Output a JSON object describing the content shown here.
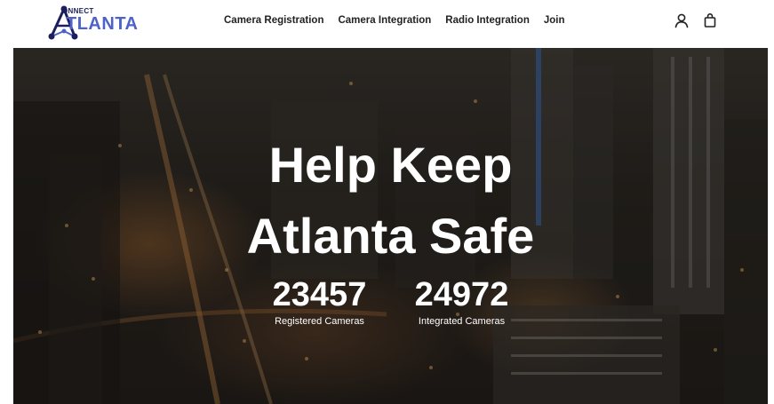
{
  "header": {
    "logo": {
      "connect_text": "ONNECT",
      "atlanta_text": "TLANTA",
      "icon": "connect-atlanta-logo-icon",
      "color_primary": "#4e62c8",
      "color_dark": "#1b1f5e"
    },
    "nav": [
      {
        "label": "Camera Registration"
      },
      {
        "label": "Camera Integration"
      },
      {
        "label": "Radio Integration"
      },
      {
        "label": "Join"
      }
    ],
    "icons": {
      "account": "user-icon",
      "cart": "shopping-bag-icon"
    }
  },
  "hero": {
    "title_line1": "Help Keep",
    "title_line2": "Atlanta Safe",
    "stats": [
      {
        "value": "23457",
        "label": "Registered Cameras"
      },
      {
        "value": "24972",
        "label": "Integrated Cameras"
      }
    ]
  }
}
